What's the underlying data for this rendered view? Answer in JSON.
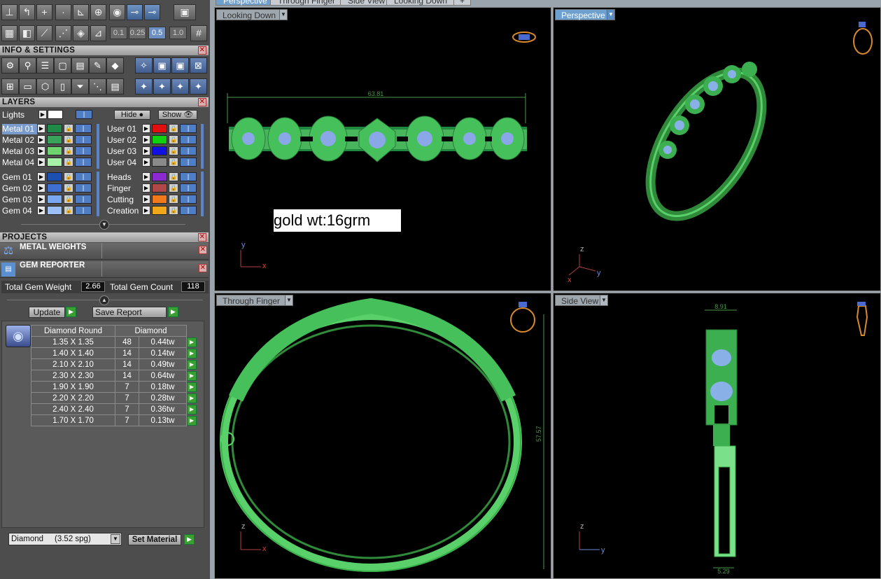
{
  "toolbar": {
    "increments": [
      "0.1",
      "0.25",
      "0.5",
      "1.0"
    ],
    "active_increment": "0.5"
  },
  "info_settings": {
    "title": "INFO & SETTINGS"
  },
  "layers": {
    "title": "LAYERS",
    "lights_label": "Lights",
    "hide_label": "Hide",
    "show_label": "Show",
    "left": [
      {
        "label": "Metal 01",
        "color": "#1f8a47",
        "selected": true
      },
      {
        "label": "Metal 02",
        "color": "#3aa35a"
      },
      {
        "label": "Metal 03",
        "color": "#6fd36f"
      },
      {
        "label": "Metal 04",
        "color": "#a8f0a8"
      },
      {
        "label": "Gem 01",
        "color": "#1d4fb0"
      },
      {
        "label": "Gem 02",
        "color": "#3f6fd0"
      },
      {
        "label": "Gem 03",
        "color": "#7aa8f0"
      },
      {
        "label": "Gem 04",
        "color": "#9cc0f6"
      }
    ],
    "right": [
      {
        "label": "User 01",
        "color": "#e01010"
      },
      {
        "label": "User 02",
        "color": "#10d010"
      },
      {
        "label": "User 03",
        "color": "#1010e0"
      },
      {
        "label": "User 04",
        "color": "#8a8a8a"
      },
      {
        "label": "Heads",
        "color": "#8a2ad0"
      },
      {
        "label": "Finger",
        "color": "#b04848"
      },
      {
        "label": "Cutting",
        "color": "#f07a1a"
      },
      {
        "label": "Creation",
        "color": "#f0a81a"
      }
    ]
  },
  "projects": {
    "title": "PROJECTS"
  },
  "metal_weights": {
    "title": "METAL WEIGHTS"
  },
  "gem_reporter": {
    "title": "GEM REPORTER",
    "total_weight_label": "Total Gem Weight",
    "total_weight_value": "2.66",
    "total_count_label": "Total Gem Count",
    "total_count_value": "118",
    "update_label": "Update",
    "save_label": "Save Report",
    "columns": [
      "Diamond Round",
      "Diamond"
    ],
    "rows": [
      {
        "size": "1.35 X 1.35",
        "count": "48",
        "weight": "0.44tw"
      },
      {
        "size": "1.40 X 1.40",
        "count": "14",
        "weight": "0.14tw"
      },
      {
        "size": "2.10 X 2.10",
        "count": "14",
        "weight": "0.49tw"
      },
      {
        "size": "2.30 X 2.30",
        "count": "14",
        "weight": "0.64tw"
      },
      {
        "size": "1.90 X 1.90",
        "count": "7",
        "weight": "0.18tw"
      },
      {
        "size": "2.20 X 2.20",
        "count": "7",
        "weight": "0.28tw"
      },
      {
        "size": "2.40 X 2.40",
        "count": "7",
        "weight": "0.36tw"
      },
      {
        "size": "1.70 X 1.70",
        "count": "7",
        "weight": "0.13tw"
      }
    ],
    "material_select": "Diamond     (3.52 spg)",
    "set_material_label": "Set Material"
  },
  "tabs": [
    "Perspective",
    "Through Finger",
    "Side View",
    "Looking Down"
  ],
  "viewports": {
    "top_left": {
      "label": "Looking Down",
      "dimension": "63.81",
      "axis_a": "y",
      "axis_b": "x"
    },
    "top_right": {
      "label": "Perspective",
      "axis_a": "z",
      "axis_b": "y",
      "axis_c": "x"
    },
    "bottom_left": {
      "label": "Through Finger",
      "dimension": "57.57",
      "axis_a": "z",
      "axis_b": "x"
    },
    "bottom_right": {
      "label": "Side View",
      "dimension_top": "8.91",
      "dimension_bottom": "5.29",
      "axis_a": "z",
      "axis_b": "y"
    }
  },
  "annotation": {
    "text": "gold wt:16grm"
  }
}
